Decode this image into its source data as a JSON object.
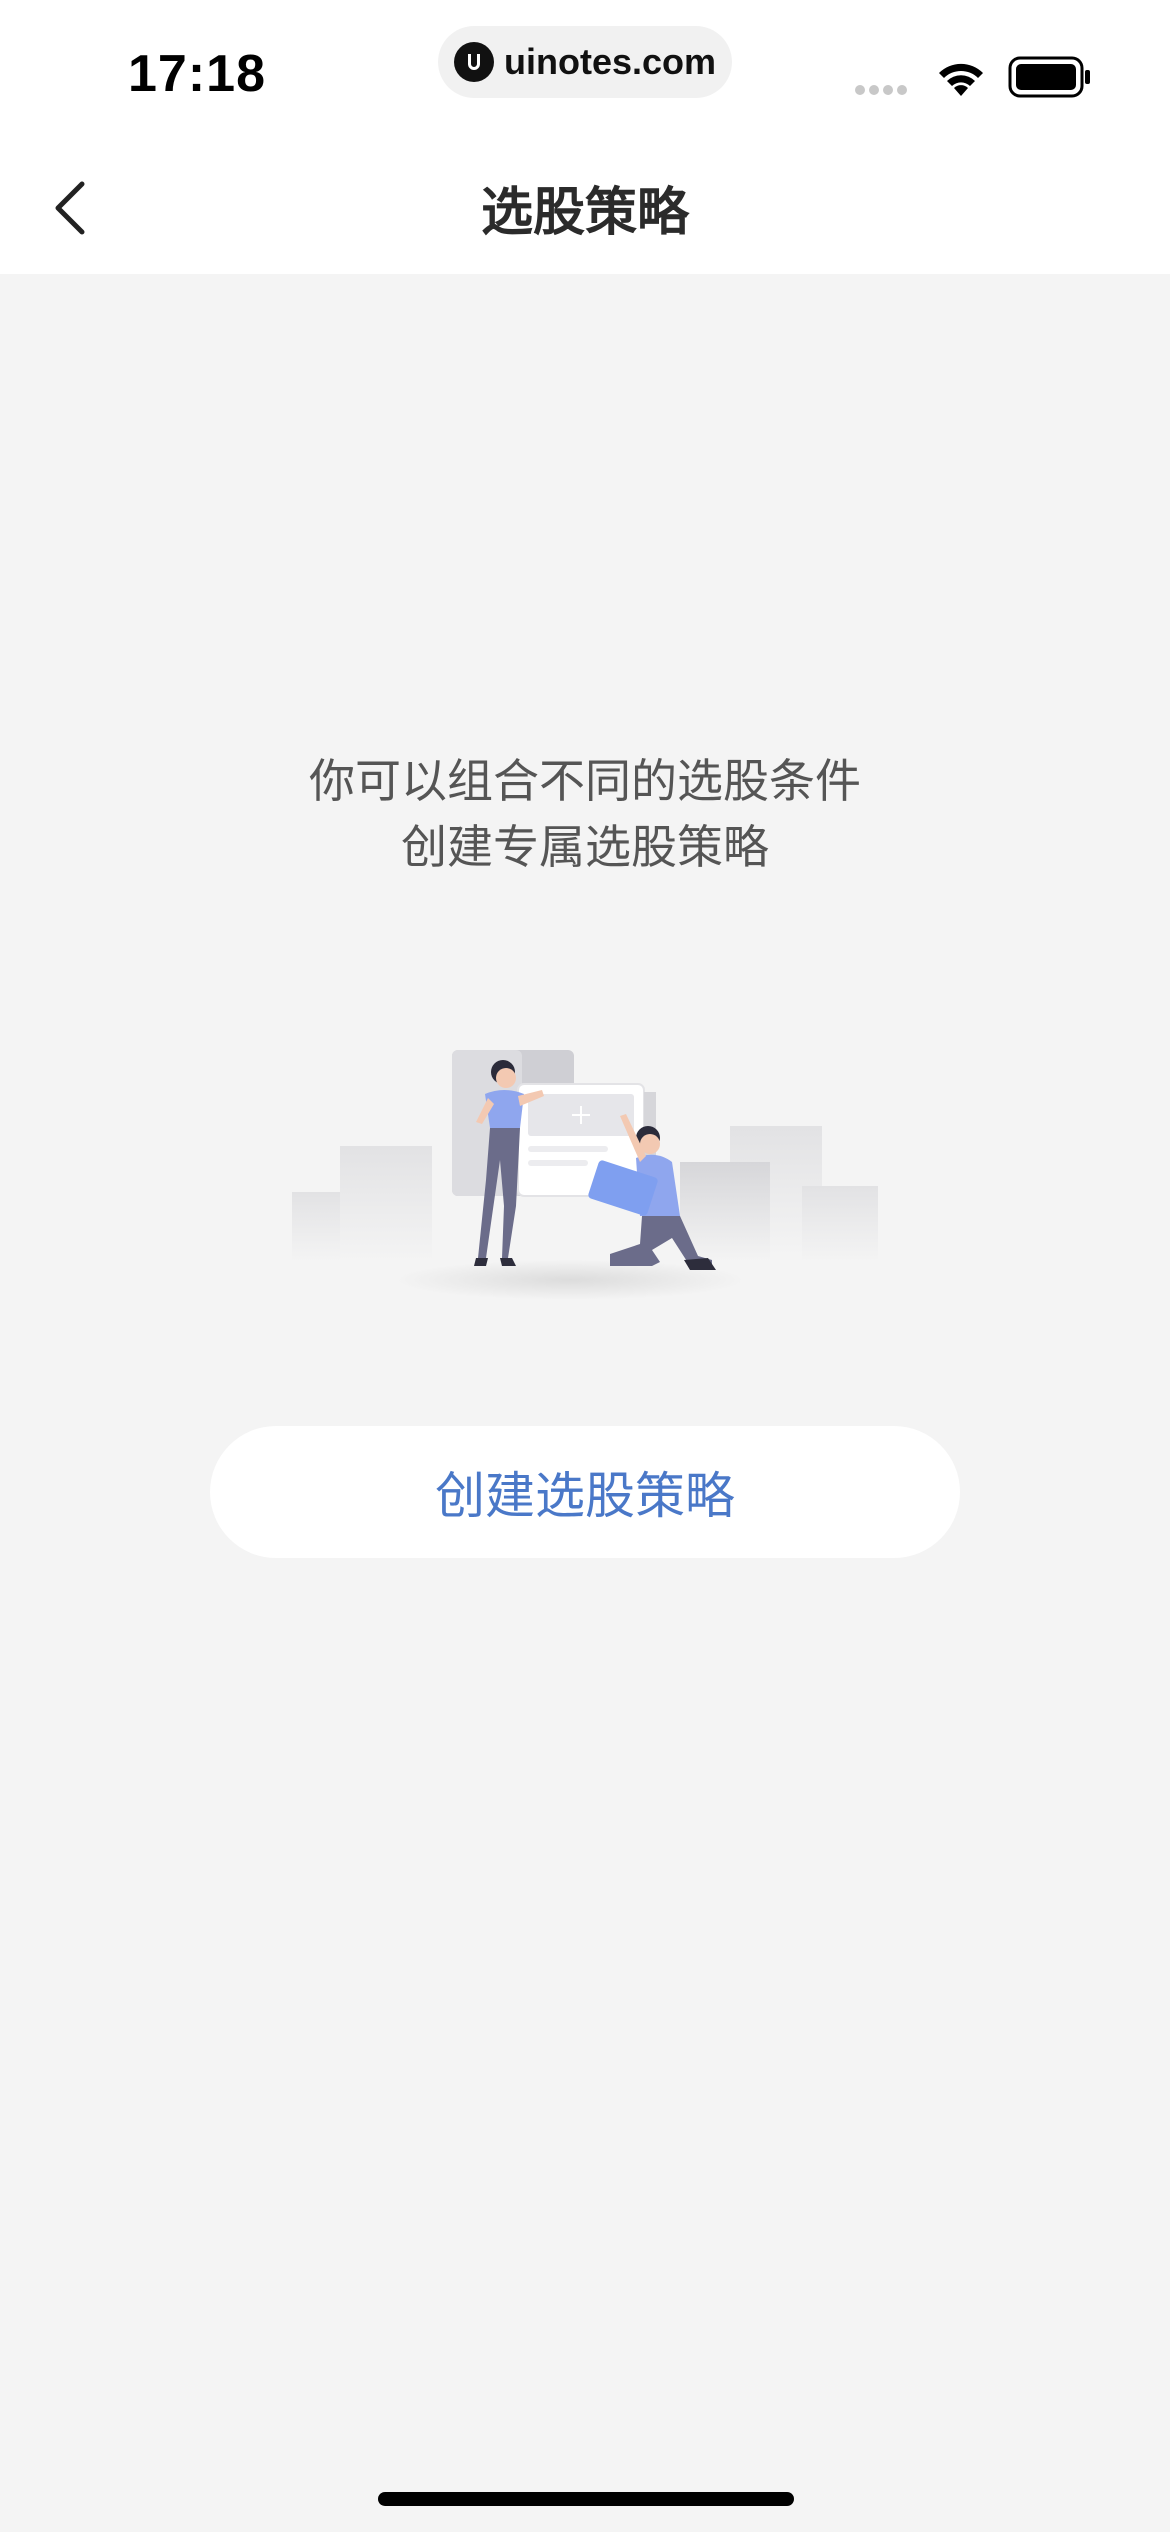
{
  "status_bar": {
    "time": "17:18",
    "url": "uinotes.com",
    "icons": [
      "signal-icon",
      "wifi-icon",
      "battery-icon"
    ]
  },
  "nav": {
    "title": "选股策略",
    "back_icon": "chevron-left-icon"
  },
  "empty_state": {
    "line1": "你可以组合不同的选股条件",
    "line2": "创建专属选股策略",
    "illustration": "people-building-strategy-illustration"
  },
  "action": {
    "create_label": "创建选股策略"
  },
  "colors": {
    "background": "#f4f4f4",
    "accent": "#4a78c8",
    "title": "#2b2b2b",
    "body_text": "#555555"
  }
}
